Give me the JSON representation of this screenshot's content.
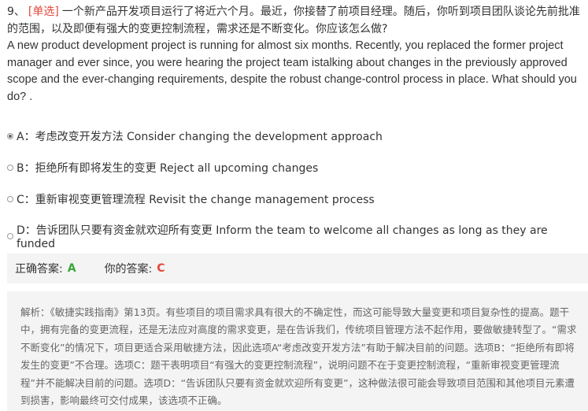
{
  "question": {
    "number": "9、",
    "tag": "[单选]",
    "text_cn": "一个新产品开发项目运行了将近六个月。最近，你接替了前项目经理。随后，你听到项目团队谈论先前批准的范围，以及即便有强大的变更控制流程，需求还是不断变化。你应该怎么做?",
    "text_en": "A new product development project is running for almost six months. Recently, you replaced the former project manager and ever since, you were hearing the project team istalking about changes in the previously approved scope and the ever-changing requirements, despite the robust change-control process in place. What should you do? ."
  },
  "options": [
    {
      "label": "A：考虑改变开发方法 Consider changing the development approach",
      "selected": true
    },
    {
      "label": "B：拒绝所有即将发生的变更 Reject all upcoming changes",
      "selected": false
    },
    {
      "label": "C：重新审视变更管理流程 Revisit the change management process",
      "selected": false
    },
    {
      "label": "D：告诉团队只要有资金就欢迎所有变更 Inform the team to welcome all changes as long as they are funded",
      "selected": false
    }
  ],
  "answer": {
    "correct_label": "正确答案:",
    "correct_value": "A",
    "your_label": "你的答案:",
    "your_value": "C"
  },
  "analysis": {
    "text": "解析：《敏捷实践指南》第13页。有些项目的项目需求具有很大的不确定性，而这可能导致大量变更和项目复杂性的提高。题干中，拥有完备的变更流程，还是无法应对高度的需求变更，是在告诉我们，传统项目管理方法不起作用，要做敏捷转型了。“需求不断变化”的情况下，项目更适合采用敏捷方法，因此选项A“考虑改变开发方法”有助于解决目前的问题。选项B：“拒绝所有即将发生的变更”不合理。选项C：题干表明项目“有强大的变更控制流程”，说明问题不在于变更控制流程，“重新审视变更管理流程”并不能解决目前的问题。选项D：“告诉团队只要有资金就欢迎所有变更”，这种做法很可能会导致项目范围和其他项目元素遭到损害，影响最终可交付成果，该选项不正确。"
  },
  "colors": {
    "tag_red": "#e2483b",
    "correct_green": "#3aa53a",
    "panel_bg": "#f4f4f4"
  }
}
